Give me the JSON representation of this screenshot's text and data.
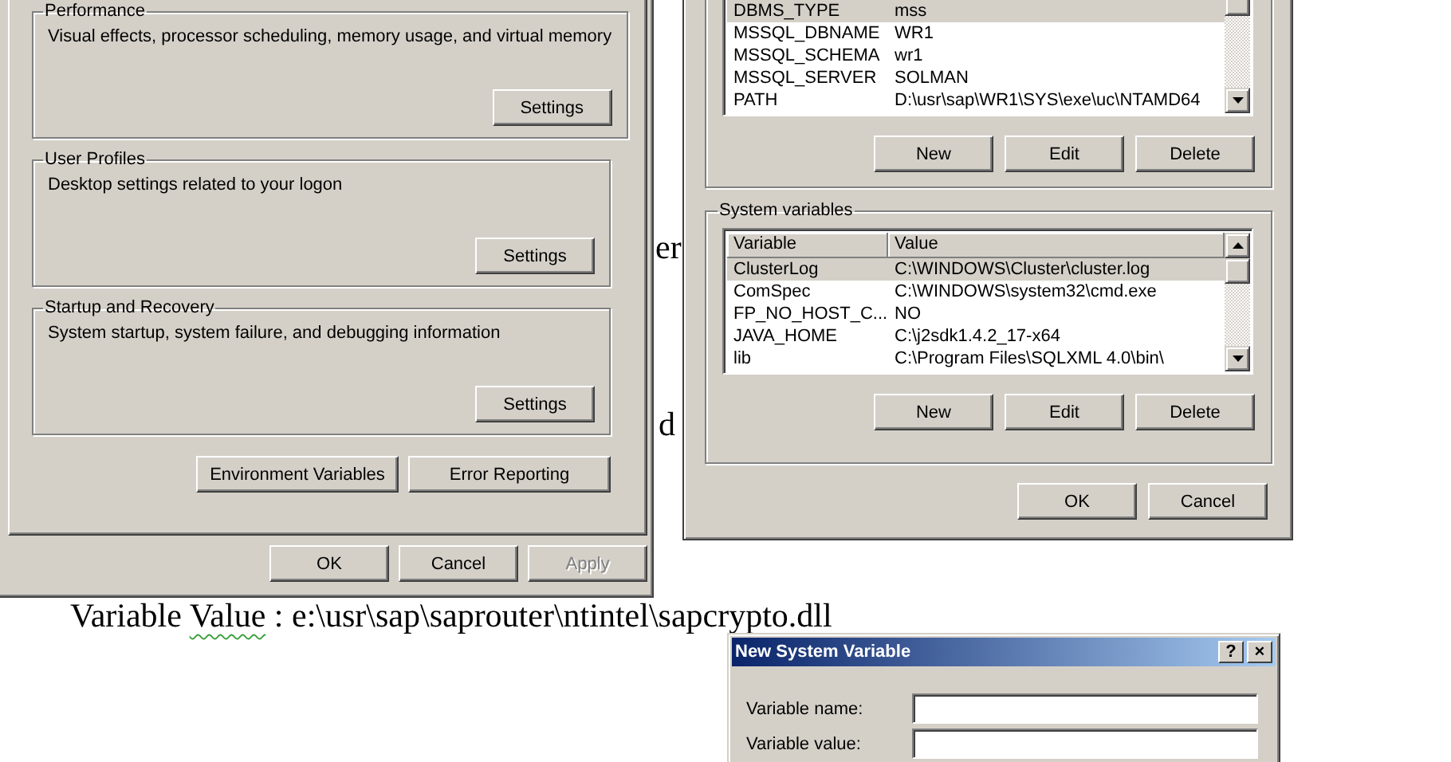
{
  "document": {
    "fragments": [
      "er",
      "d"
    ],
    "line": [
      {
        "text": "Variable ",
        "flagged": false
      },
      {
        "text": "Value",
        "flagged": true
      },
      {
        "text": " : e:\\usr\\sap\\saprouter\\ntintel\\sapcrypto.dll",
        "flagged": false
      }
    ]
  },
  "performance_dialog": {
    "groups": [
      {
        "title": "Performance",
        "description": "Visual effects, processor scheduling, memory usage, and virtual memory",
        "button": "Settings"
      },
      {
        "title": "User Profiles",
        "description": "Desktop settings related to your logon",
        "button": "Settings"
      },
      {
        "title": "Startup and Recovery",
        "description": "System startup, system failure, and debugging information",
        "button": "Settings"
      }
    ],
    "action_buttons": [
      "Environment Variables",
      "Error Reporting"
    ],
    "footer_buttons": [
      {
        "label": "OK",
        "disabled": false
      },
      {
        "label": "Cancel",
        "disabled": false
      },
      {
        "label": "Apply",
        "disabled": true
      }
    ]
  },
  "environment_dialog": {
    "user_variables": {
      "rows": [
        {
          "variable": "DBMS_TYPE",
          "value": "mss",
          "selected": true
        },
        {
          "variable": "MSSQL_DBNAME",
          "value": "WR1",
          "selected": false
        },
        {
          "variable": "MSSQL_SCHEMA",
          "value": "wr1",
          "selected": false
        },
        {
          "variable": "MSSQL_SERVER",
          "value": "SOLMAN",
          "selected": false
        },
        {
          "variable": "PATH",
          "value": "D:\\usr\\sap\\WR1\\SYS\\exe\\uc\\NTAMD64",
          "selected": false
        }
      ],
      "buttons": [
        "New",
        "Edit",
        "Delete"
      ]
    },
    "system_variables": {
      "title": "System variables",
      "columns": [
        "Variable",
        "Value"
      ],
      "rows": [
        {
          "variable": "ClusterLog",
          "value": "C:\\WINDOWS\\Cluster\\cluster.log",
          "selected": true
        },
        {
          "variable": "ComSpec",
          "value": "C:\\WINDOWS\\system32\\cmd.exe",
          "selected": false
        },
        {
          "variable": "FP_NO_HOST_C...",
          "value": "NO",
          "selected": false
        },
        {
          "variable": "JAVA_HOME",
          "value": "C:\\j2sdk1.4.2_17-x64",
          "selected": false
        },
        {
          "variable": "lib",
          "value": "C:\\Program Files\\SQLXML 4.0\\bin\\",
          "selected": false
        }
      ],
      "buttons": [
        "New",
        "Edit",
        "Delete"
      ]
    },
    "footer_buttons": [
      "OK",
      "Cancel"
    ]
  },
  "new_variable_dialog": {
    "title": "New System Variable",
    "title_buttons": [
      "?",
      "×"
    ],
    "fields": [
      {
        "label": "Variable name:"
      },
      {
        "label": "Variable value:"
      }
    ]
  }
}
